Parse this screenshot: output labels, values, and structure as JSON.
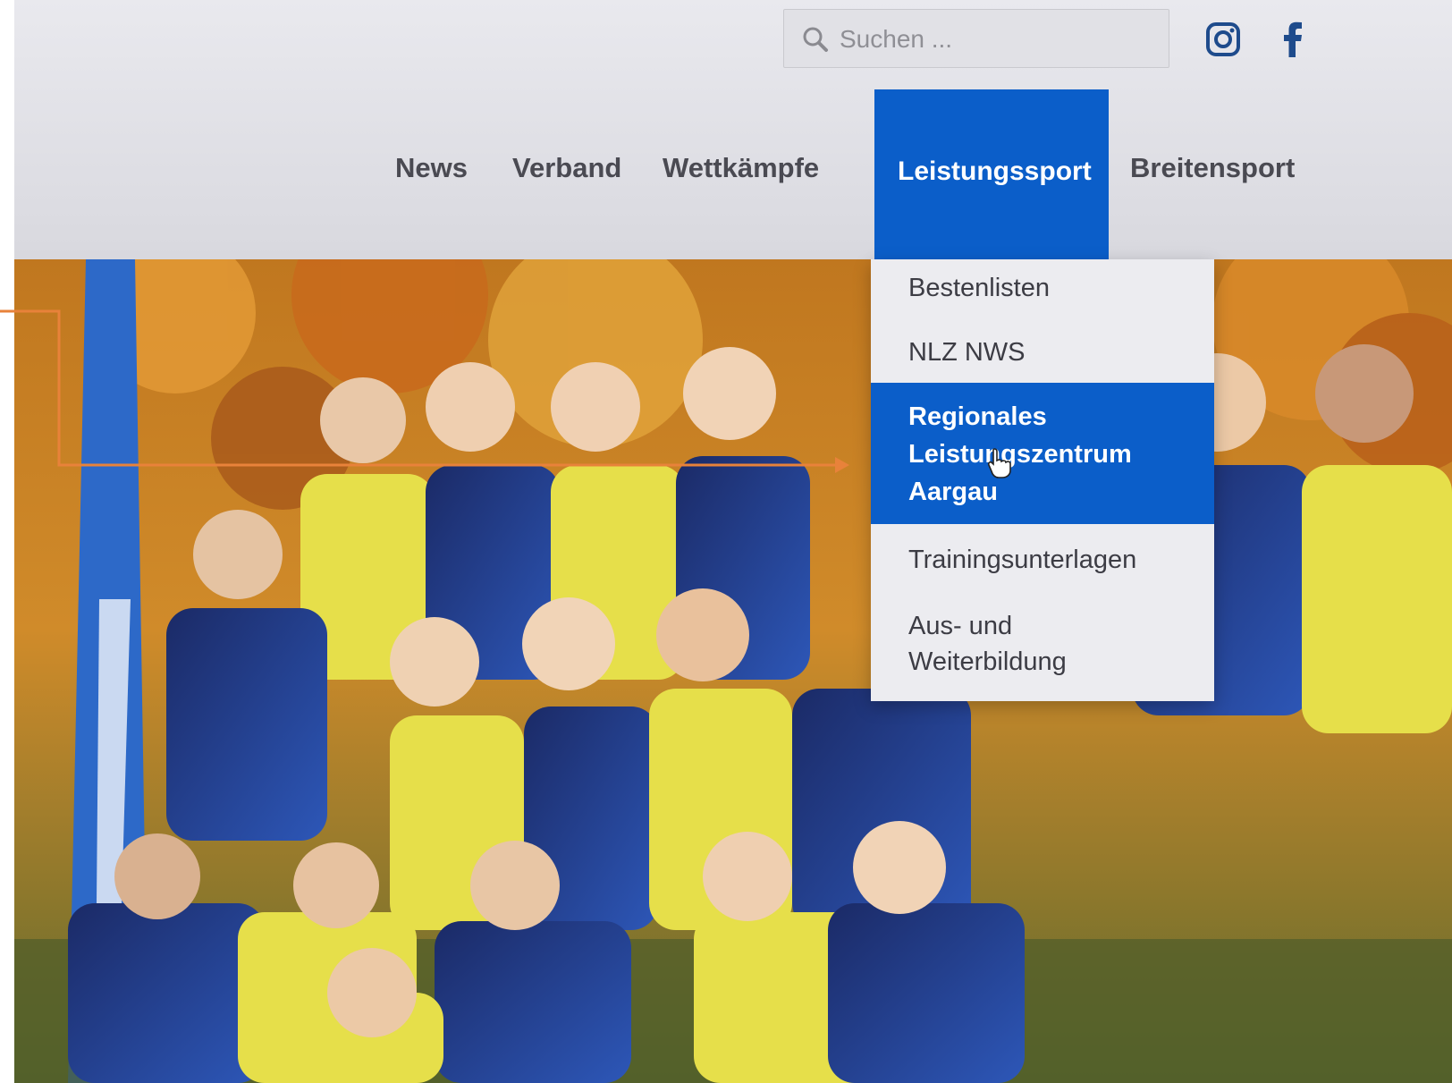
{
  "search": {
    "placeholder": "Suchen ..."
  },
  "social": {
    "instagram_icon": "instagram-icon",
    "facebook_icon": "facebook-icon"
  },
  "nav": {
    "items": [
      "News",
      "Verband",
      "Wettkämpfe",
      "Leistungssport",
      "Breitensport"
    ],
    "active": "Leistungssport"
  },
  "dropdown": {
    "items": [
      {
        "label": "Bestenlisten"
      },
      {
        "label": "NLZ NWS"
      },
      {
        "label_lines": [
          "Regionales",
          "Leistungszentrum",
          "Aargau"
        ],
        "active": true
      },
      {
        "label": "Trainingsunterlagen"
      },
      {
        "label_lines": [
          "Aus- und",
          "Weiterbildung"
        ]
      }
    ]
  },
  "colors": {
    "accent": "#0b5ec9",
    "annotation": "#e8823a",
    "jersey_blue": "#1a2a6a",
    "jersey_yellow": "#e8e24a"
  },
  "cursor": "hand-pointer-icon"
}
